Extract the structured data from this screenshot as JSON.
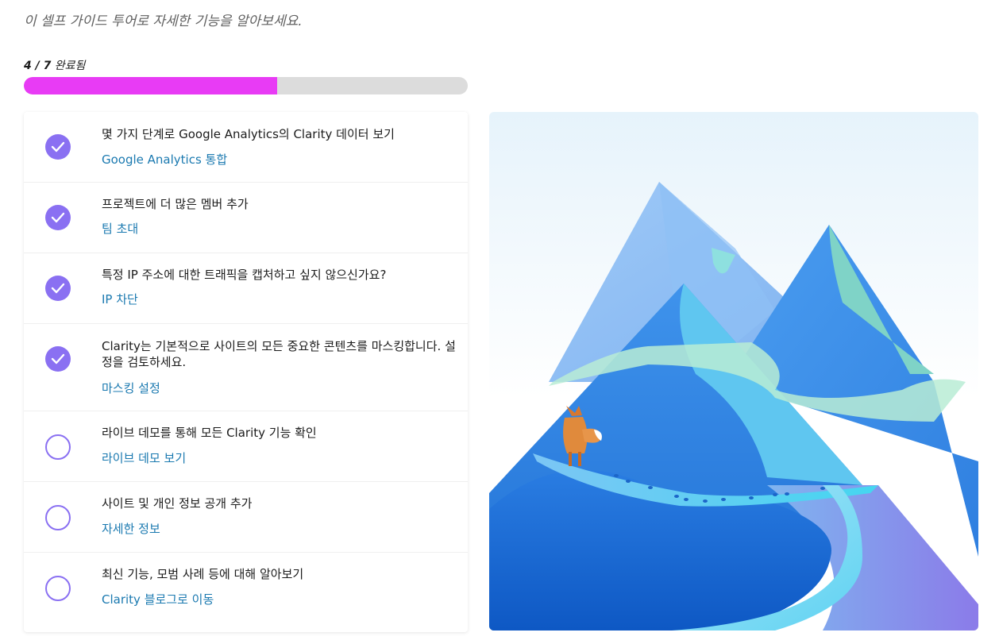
{
  "subtitle": "이 셀프 가이드 투어로 자세한 기능을 알아보세요.",
  "progress": {
    "count": "4 / 7",
    "done_label": "완료됨",
    "completed": 4,
    "total": 7,
    "fill_color": "#e83bf5"
  },
  "tasks": [
    {
      "title": "몇 가지 단계로 Google Analytics의 Clarity 데이터 보기",
      "link": "Google Analytics 통합",
      "completed": true
    },
    {
      "title": "프로젝트에 더 많은 멤버 추가",
      "link": "팀 초대",
      "completed": true
    },
    {
      "title": "특정 IP 주소에 대한 트래픽을 캡처하고 싶지 않으신가요?",
      "link": "IP 차단",
      "completed": true
    },
    {
      "title": "Clarity는 기본적으로 사이트의 모든 중요한 콘텐츠를 마스킹합니다. 설정을 검토하세요.",
      "link": "마스킹 설정",
      "completed": true
    },
    {
      "title": "라이브 데모를 통해 모든 Clarity 기능 확인",
      "link": "라이브 데모 보기",
      "completed": false
    },
    {
      "title": "사이트 및 개인 정보 공개 추가",
      "link": "자세한 정보",
      "completed": false
    },
    {
      "title": "최신 기능, 모범 사례 등에 대해 알아보기",
      "link": "Clarity 블로그로 이동",
      "completed": false
    }
  ],
  "colors": {
    "accent": "#8a70f2",
    "link": "#1a79b0"
  },
  "icons": {
    "completed": "checkmark-circle-icon",
    "pending": "empty-circle-icon"
  }
}
